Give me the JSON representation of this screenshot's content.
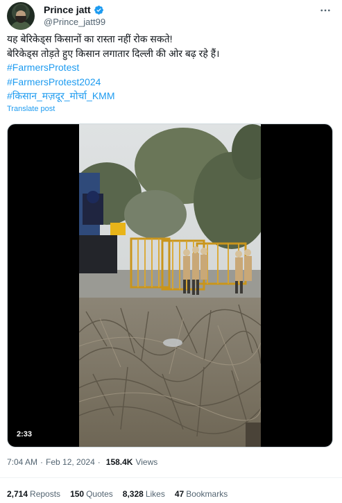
{
  "author": {
    "display_name": "Prince jatt",
    "handle": "@Prince_jatt99",
    "verified": true
  },
  "tweet": {
    "lines": [
      "यह बेरिकेड्स किसानों का रास्ता नहीं रोक सकते!",
      "बेरिकेड्स तोड़ते हुए किसान लगातार दिल्ली की ओर बढ़ रहे हैं।"
    ],
    "hashtags": [
      "#FarmersProtest",
      "#FarmersProtest2024",
      "#किसान_मज़दूर_मोर्चा_KMM"
    ],
    "translate_label": "Translate post"
  },
  "media": {
    "type": "video",
    "duration": "2:33"
  },
  "meta": {
    "time": "7:04 AM",
    "date": "Feb 12, 2024",
    "views_count": "158.4K",
    "views_label": "Views",
    "separator": "·"
  },
  "stats": {
    "reposts": {
      "count": "2,714",
      "label": "Reposts"
    },
    "quotes": {
      "count": "150",
      "label": "Quotes"
    },
    "likes": {
      "count": "8,328",
      "label": "Likes"
    },
    "bookmarks": {
      "count": "47",
      "label": "Bookmarks"
    }
  },
  "colors": {
    "accent": "#1d9bf0",
    "text": "#0f1419",
    "muted": "#536471"
  },
  "icons": {
    "verified": "verified-badge-icon",
    "more": "more-options-icon"
  }
}
